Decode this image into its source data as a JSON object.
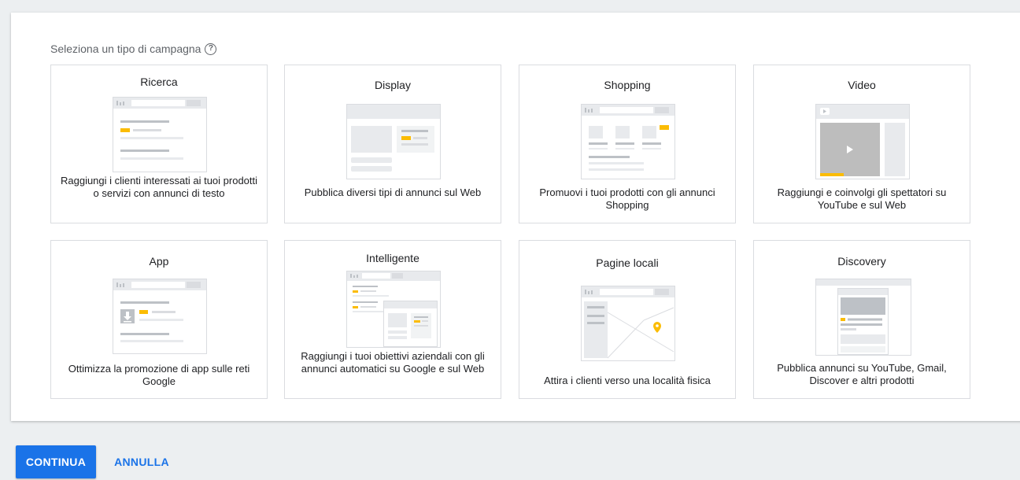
{
  "heading": "Seleziona un tipo di campagna",
  "help_icon": "help-circle-icon",
  "colors": {
    "accent": "#1a73e8",
    "highlight": "#fbbc04",
    "thumb_gray": "#dadce0"
  },
  "campaign_types": [
    {
      "title": "Ricerca",
      "description": "Raggiungi i clienti interessati ai tuoi prodotti o servizi con annunci di testo"
    },
    {
      "title": "Display",
      "description": "Pubblica diversi tipi di annunci sul Web"
    },
    {
      "title": "Shopping",
      "description": "Promuovi i tuoi prodotti con gli annunci Shopping"
    },
    {
      "title": "Video",
      "description": "Raggiungi e coinvolgi gli spettatori su YouTube e sul Web"
    },
    {
      "title": "App",
      "description": "Ottimizza la promozione di app sulle reti Google"
    },
    {
      "title": "Intelligente",
      "description": "Raggiungi i tuoi obiettivi aziendali con gli annunci automatici su Google e sul Web"
    },
    {
      "title": "Pagine locali",
      "description": "Attira i clienti verso una località fisica"
    },
    {
      "title": "Discovery",
      "description": "Pubblica annunci su YouTube, Gmail, Discover e altri prodotti"
    }
  ],
  "actions": {
    "continue_label": "CONTINUA",
    "cancel_label": "ANNULLA"
  }
}
